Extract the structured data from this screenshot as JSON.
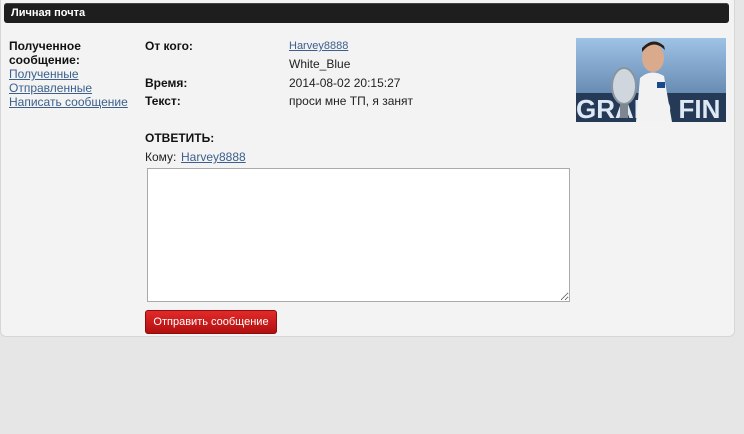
{
  "header": {
    "title": "Личная почта"
  },
  "sidebar": {
    "title": "Полученное сообщение:",
    "links": [
      "Полученные",
      "Отправленные",
      "Написать сообщение"
    ]
  },
  "message": {
    "from_label": "От кого:",
    "from_user": "Harvey8888",
    "from_group": "White_Blue",
    "time_label": "Время:",
    "time_value": "2014-08-02 20:15:27",
    "text_label": "Текст:",
    "text_value": "проси мне ТП, я занят"
  },
  "reply": {
    "title": "ОТВЕТИТЬ:",
    "to_label": "Кому:",
    "to_user": "Harvey8888",
    "body_value": "",
    "send_label": "Отправить сообщение"
  },
  "colors": {
    "link": "#3c5f8c",
    "button": "#c91b1b",
    "header": "#1e1e1e"
  },
  "photo_text": "GRAND FIN"
}
